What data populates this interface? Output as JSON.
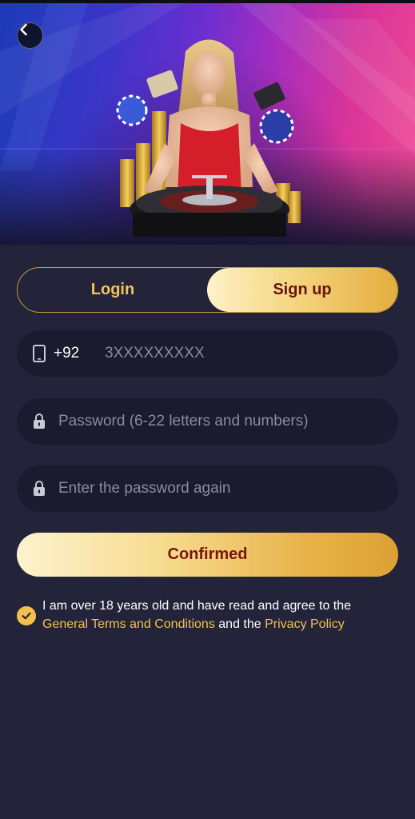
{
  "hero": {
    "background_colors": [
      "#1d3bb8",
      "#6a2fd0",
      "#d8349a",
      "#f04a92"
    ]
  },
  "nav": {
    "back_icon": "chevron-left-icon"
  },
  "tabs": [
    {
      "label": "Login",
      "active": false
    },
    {
      "label": "Sign up",
      "active": true
    }
  ],
  "form": {
    "phone": {
      "icon": "phone-icon",
      "prefix": "+92",
      "placeholder": "3XXXXXXXXX",
      "value": ""
    },
    "password": {
      "icon": "lock-icon",
      "placeholder": "Password (6-22 letters and numbers)",
      "value": ""
    },
    "confirm_password": {
      "icon": "lock-icon",
      "placeholder": "Enter the password again",
      "value": ""
    },
    "submit_label": "Confirmed"
  },
  "agreement": {
    "checked": true,
    "text_before": "I am over 18 years old and have read and agree to the ",
    "terms_link": "General Terms and Conditions",
    "text_middle": " and the ",
    "privacy_link": "Privacy Policy"
  },
  "colors": {
    "background": "#23243a",
    "field": "#1a1b2e",
    "accent_gold": "#f2c04d",
    "button_text": "#7a1616"
  }
}
